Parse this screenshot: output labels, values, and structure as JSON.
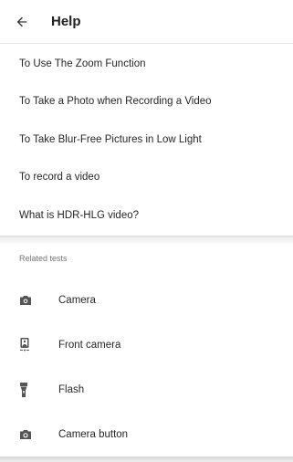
{
  "header": {
    "title": "Help",
    "back_icon": "arrow-back-icon"
  },
  "topics": [
    {
      "label": "To Use The Zoom Function"
    },
    {
      "label": "To Take a Photo when Recording a Video"
    },
    {
      "label": "To Take Blur-Free Pictures in Low Light"
    },
    {
      "label": "To record a video"
    },
    {
      "label": "What is HDR-HLG video?"
    }
  ],
  "related": {
    "header": "Related tests",
    "items": [
      {
        "label": "Camera",
        "icon": "camera-icon"
      },
      {
        "label": "Front camera",
        "icon": "front-camera-icon"
      },
      {
        "label": "Flash",
        "icon": "flashlight-icon"
      },
      {
        "label": "Camera button",
        "icon": "camera-button-icon"
      }
    ]
  },
  "colors": {
    "text": "#262626",
    "icon": "#555555",
    "subheader": "#757575"
  }
}
